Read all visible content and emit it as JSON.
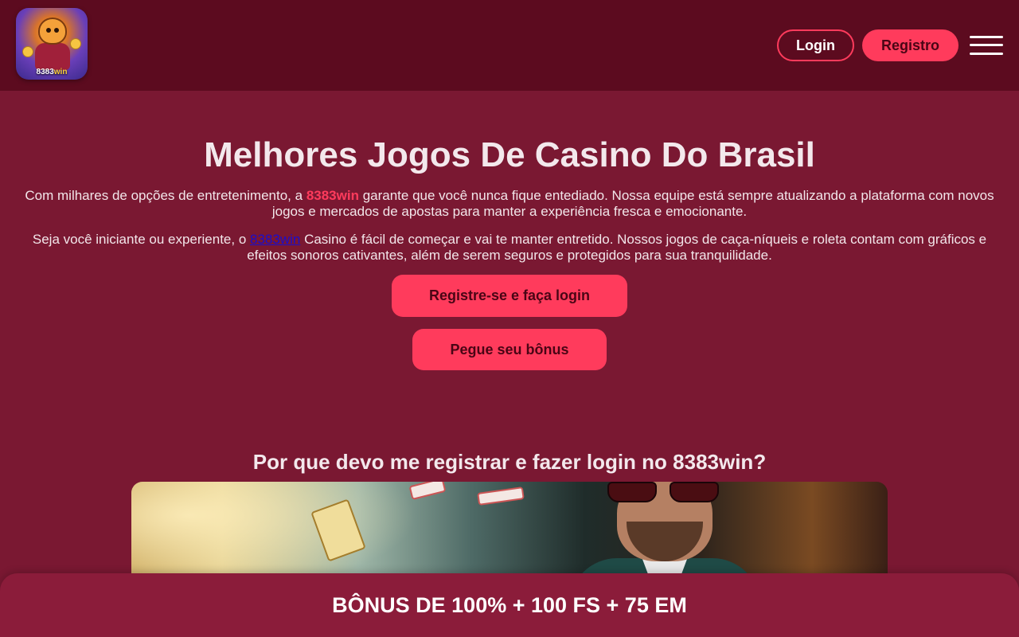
{
  "header": {
    "logo_text_main": "8383",
    "logo_text_accent": "win",
    "login_label": "Login",
    "register_label": "Registro"
  },
  "hero": {
    "title": "Melhores Jogos De Casino Do Brasil",
    "p1_before": "Com milhares de opções de entretenimento, a ",
    "p1_brand": "8383win",
    "p1_after": " garante que você nunca fique entediado. Nossa equipe está sempre atualizando a plataforma com novos jogos e mercados de apostas para manter a experiência fresca e emocionante.",
    "p2_before": "Seja você iniciante ou experiente, o ",
    "p2_link": "8383win",
    "p2_after": " Casino é fácil de começar e vai te manter entretido. Nossos jogos de caça-níqueis e roleta contam com gráficos e efeitos sonoros cativantes, além de serem seguros e protegidos para sua tranquilidade.",
    "cta_register": "Registre-se e faça login",
    "cta_bonus": "Pegue seu bônus"
  },
  "section": {
    "title": "Por que devo me registrar e fazer login no 8383win?"
  },
  "bottom_bar": {
    "text": "BÔNUS DE 100% + 100 FS + 75 EM"
  },
  "colors": {
    "page_bg": "#7a1832",
    "header_bg": "#5c0b1f",
    "accent": "#ff3b5c",
    "bottom_bar_bg": "#8b1c3a"
  },
  "icons": {
    "menu": "hamburger-icon"
  }
}
